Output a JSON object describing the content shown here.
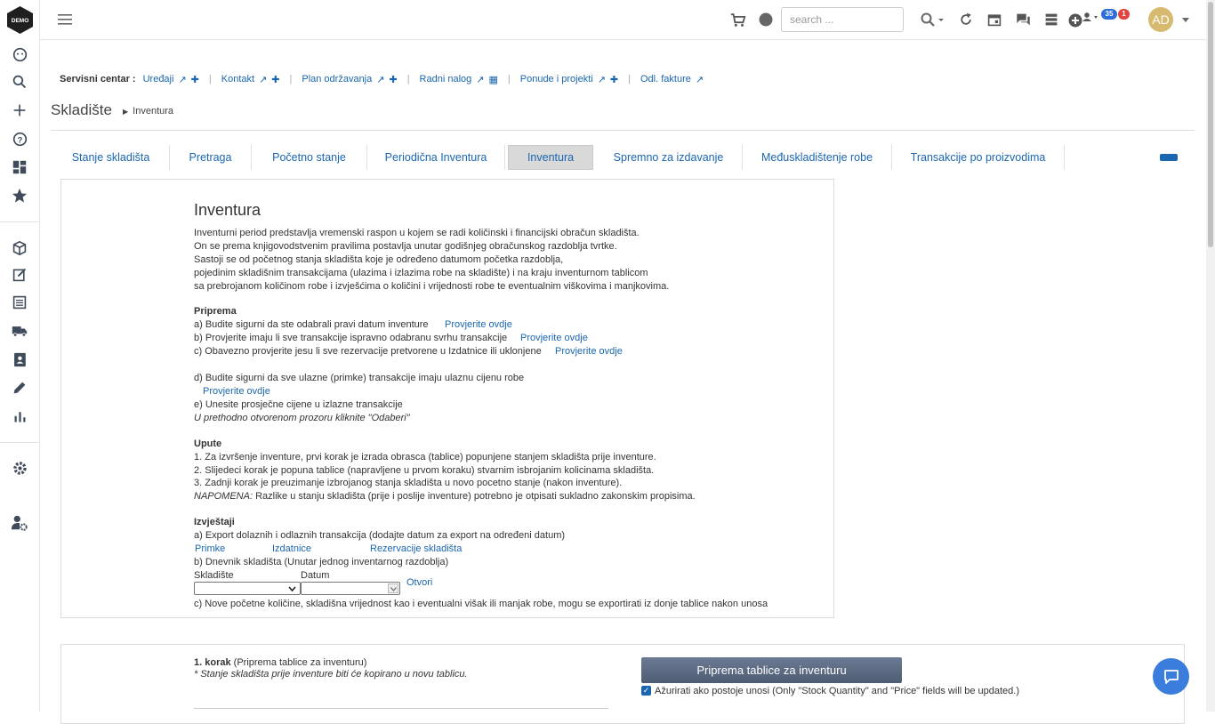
{
  "app": {
    "logo_text": "DEMO"
  },
  "sidebar": {
    "icons": [
      "face-icon",
      "search-icon",
      "plus-icon",
      "help-icon",
      "dashboard-icon",
      "star-icon",
      "box-icon",
      "edit-note-icon",
      "list-icon",
      "truck-icon",
      "contacts-icon",
      "pencil-icon",
      "bar-chart-icon",
      "settings-icon",
      "user-settings-icon"
    ]
  },
  "topbar": {
    "search_placeholder": "search ...",
    "badge_blue": "35",
    "badge_red": "1",
    "avatar": "AD",
    "colors": {
      "badge_blue": "#2e6dd9",
      "badge_red": "#e0443e",
      "avatar": "#d7b96f"
    }
  },
  "service": {
    "label": "Servisni centar :",
    "links": [
      {
        "text": "Uređaji"
      },
      {
        "text": "Kontakt"
      },
      {
        "text": "Plan održavanja"
      },
      {
        "text": "Radni nalog"
      },
      {
        "text": "Ponude i projekti"
      },
      {
        "text": "Odl. fakture"
      }
    ]
  },
  "page": {
    "title": "Skladište",
    "breadcrumb": "Inventura"
  },
  "tabs": [
    "Stanje skladišta",
    "Pretraga",
    "Početno stanje",
    "Periodična Inventura",
    "Inventura",
    "Spremno za izdavanje",
    "Međuskladištenje robe",
    "Transakcije po proizvodima"
  ],
  "active_tab": "Inventura",
  "main": {
    "heading": "Inventura",
    "intro": [
      "Inventurni period predstavlja vremenski raspon u kojem se radi količinski i financijski obračun skladišta.",
      "On se prema knjigovodstvenim pravilima postavlja unutar godišnjeg obračunskog razdoblja tvrtke.",
      "Sastoji se od početnog stanja skladišta koje je određeno datumom početka razdoblja,",
      "pojedinim skladišnim transakcijama (ulazima i izlazima robe na skladište) i na kraju inventurnom tablicom",
      "sa prebrojanom količinom robe i izvješćima o količini i vrijednosti robe te eventualnim viškovima i manjkovima."
    ],
    "priprema_title": "Priprema",
    "priprema": {
      "a": "a) Budite sigurni da ste odabrali pravi datum inventure",
      "b": "b) Provjerite imaju li sve transakcije ispravno odabranu svrhu transakcije",
      "c": "c) Obavezno provjerite jesu li sve rezervacije pretvorene u Izdatnice ili uklonjene",
      "d": "d) Budite sigurni da sve ulazne (primke) transakcije imaju ulaznu cijenu robe",
      "e": "e) Unesite prosječne cijene u izlazne transakcije",
      "e_note": "U prethodno otvorenom prozoru kliknite \"Odaberi\"",
      "check_link": "Provjerite ovdje"
    },
    "upute_title": "Upute",
    "upute": [
      "1. Za izvršenje inventure, prvi korak je izrada obrasca (tablice) popunjene stanjem skladišta prije inventure.",
      "2. Slijedeci korak je popuna tablice (napravljene u prvom koraku) stvarnim isbrojanim kolicinama skladišta.",
      "3. Zadnji korak je preuzimanje izbrojanog stanja skladišta u novo pocetno stanje (nakon inventure)."
    ],
    "note_label": "NAPOMENA:",
    "note_text": " Razlike u stanju skladišta (prije i poslije inventure) potrebno je otpisati sukladno zakonskim propisima.",
    "izvjestaji_title": "Izvještaji",
    "izv_a": "a) Export dolaznih i odlaznih transakcija (dodajte datum za export na određeni datum)",
    "izv_links": [
      "Primke",
      "Izdatnice",
      "Rezervacije skladišta"
    ],
    "izv_b": "b) Dnevnik skladišta (Unutar jednog inventarnog razdoblja)",
    "label_skladiste": "Skladište",
    "label_datum": "Datum",
    "otvori": "Otvori",
    "izv_c": "c) Nove početne količine, skladišna vrijednost kao i eventualni višak ili manjak robe, mogu se exportirati iz donje tablice nakon unosa"
  },
  "step1": {
    "title_bold": "1. korak",
    "title_rest": " (Priprema tablice za inventuru)",
    "note": "* Stanje skladišta prije inventure biti će kopirano u novu tablicu.",
    "button": "Priprema tablice za inventuru",
    "checkbox_label": "Ažurirati ako postoje unosi (Only \"Stock Quantity\" and \"Price\" fields will be updated.)",
    "checkbox_checked": true
  }
}
